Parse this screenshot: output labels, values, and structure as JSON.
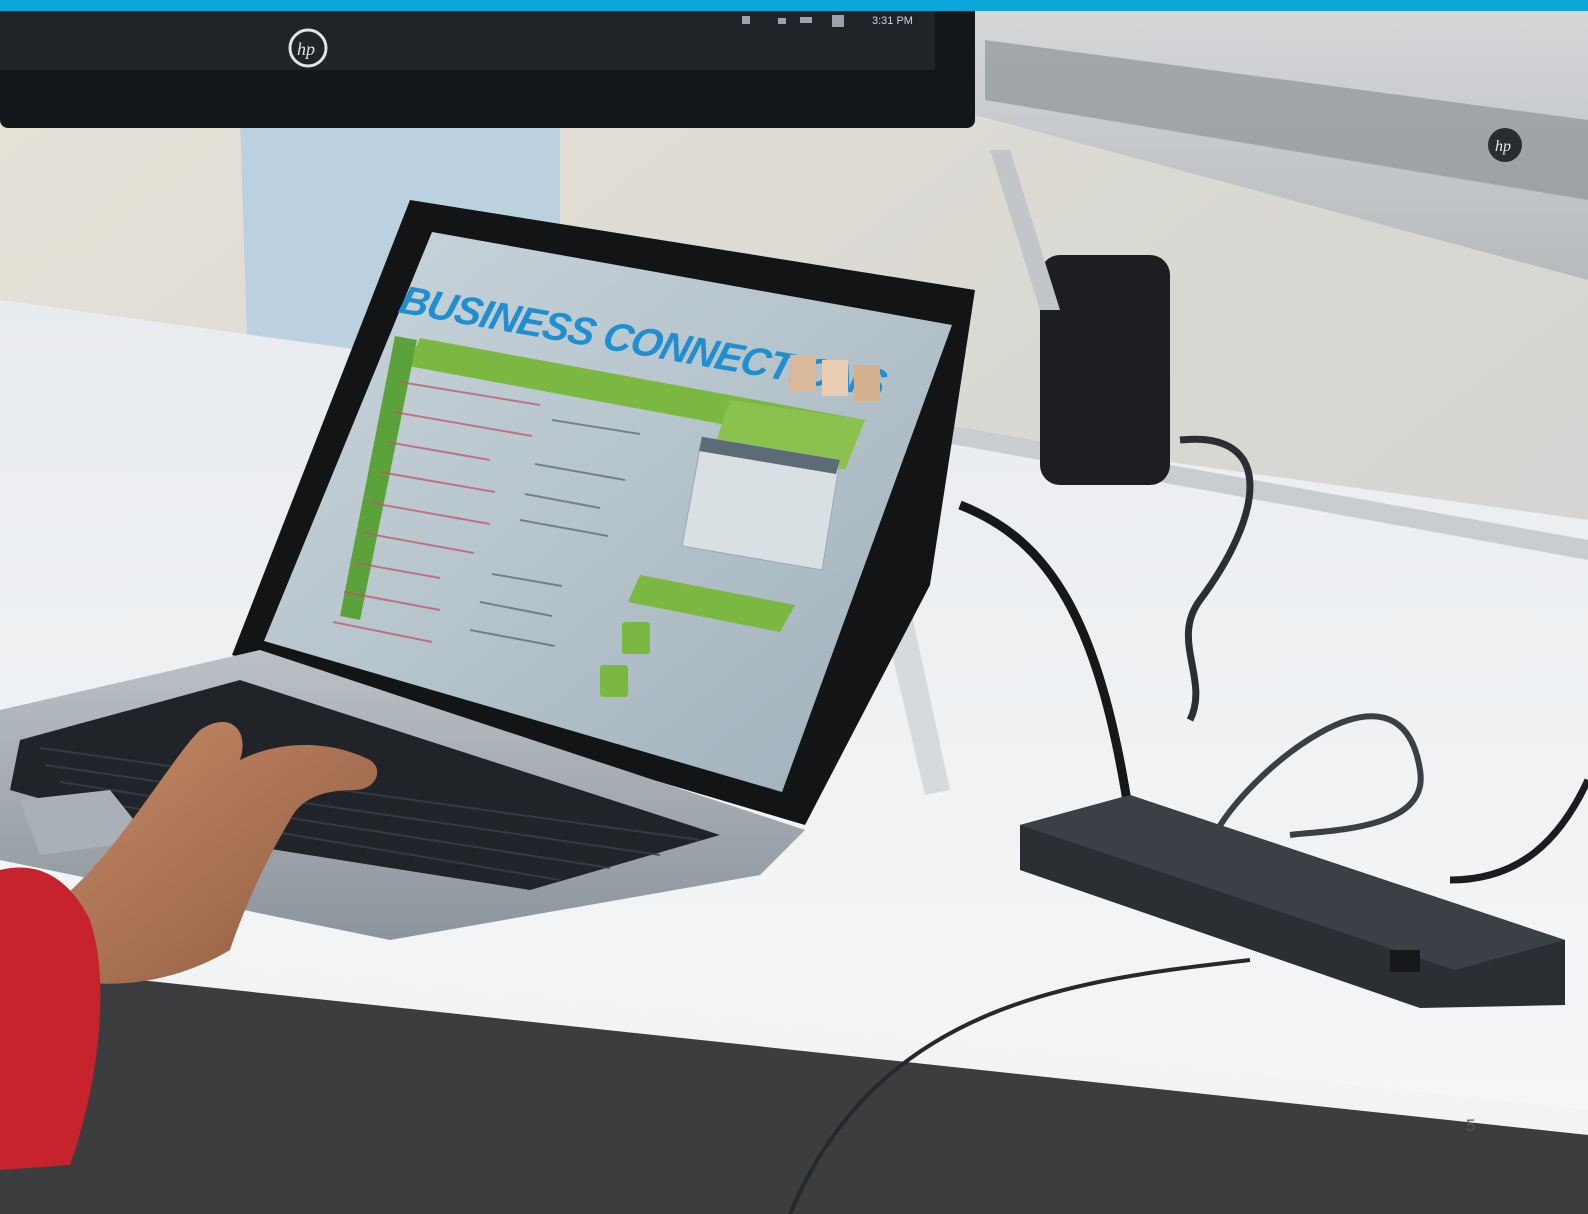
{
  "page": {
    "number": "5",
    "accent_color": "#0aa7d8"
  },
  "monitor_left": {
    "brand": "hp",
    "clock_time": "3:31 PM"
  },
  "monitor_right": {
    "brand": "hp"
  },
  "laptop_screen": {
    "app_title": "BUSINESS CONNECTIONS"
  },
  "icons": [
    "hp-logo-icon",
    "hp-logo-icon",
    "taskbar-icons",
    "calendar-icon"
  ]
}
